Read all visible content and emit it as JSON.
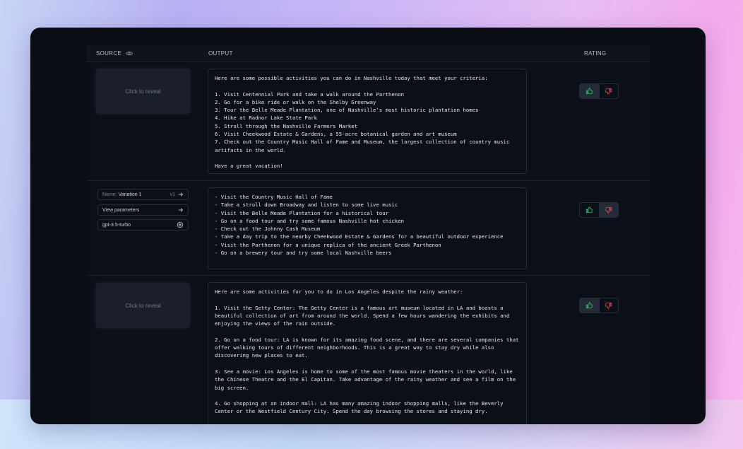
{
  "table": {
    "headers": {
      "source": "SOURCE",
      "output": "OUTPUT",
      "rating": "RATING"
    }
  },
  "rows": [
    {
      "reveal_label": "Click to reveal",
      "output": "Here are some possible activities you can do in Nashville today that meet your criteria:\n\n1. Visit Centennial Park and take a walk around the Parthenon\n2. Go for a bike ride or walk on the Shelby Greenway\n3. Tour the Belle Meade Plantation, one of Nashville's most historic plantation homes\n4. Hike at Radnor Lake State Park\n5. Stroll through the Nashville Farmers Market\n6. Visit Cheekwood Estate & Gardens, a 55-acre botanical garden and art museum\n7. Check out the Country Music Hall of Fame and Museum, the largest collection of country music artifacts in the world.\n\nHave a great vacation!",
      "rating": "up"
    },
    {
      "variation": {
        "name_prefix": "Name:",
        "name": "Variation 1",
        "version": "v1"
      },
      "params_label": "View parameters",
      "model": "gpt-3.5-turbo",
      "output": "- Visit the Country Music Hall of Fame\n- Take a stroll down Broadway and listen to some live music\n- Visit the Belle Meade Plantation for a historical tour\n- Go on a food tour and try some famous Nashville hot chicken\n- Check out the Johnny Cash Museum\n- Take a day trip to the nearby Cheekwood Estate & Gardens for a beautiful outdoor experience\n- Visit the Parthenon for a unique replica of the ancient Greek Parthenon\n- Go on a brewery tour and try some local Nashville beers",
      "rating": "down"
    },
    {
      "reveal_label": "Click to reveal",
      "output": "Here are some activities for you to do in Los Angeles despite the rainy weather:\n\n1. Visit the Getty Center: The Getty Center is a famous art museum located in LA and boasts a beautiful collection of art from around the world. Spend a few hours wandering the exhibits and enjoying the views of the rain outside.\n\n2. Go on a food tour: LA is known for its amazing food scene, and there are several companies that offer walking tours of different neighborhoods. This is a great way to stay dry while also discovering new places to eat.\n\n3. See a movie: Los Angeles is home to some of the most famous movie theaters in the world, like the Chinese Theatre and the El Capitan. Take advantage of the rainy weather and see a film on the big screen.\n\n4. Go shopping at an indoor mall: LA has many amazing indoor shopping malls, like the Beverly Center or the Westfield Century City. Spend the day browsing the stores and staying dry.",
      "rating": "up"
    }
  ],
  "colors": {
    "thumbs_up": "#3fbf6a",
    "thumbs_down": "#e5484d"
  }
}
